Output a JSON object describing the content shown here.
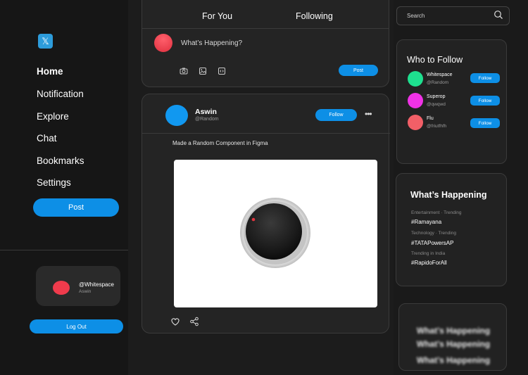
{
  "sidebar": {
    "logo": "𝕏",
    "nav": [
      "Home",
      "Notification",
      "Explore",
      "Chat",
      "Bookmarks",
      "Settings"
    ],
    "post_label": "Post",
    "profile": {
      "handle": "@Whitespace",
      "name": "Aswin"
    },
    "logout_label": "Log Out"
  },
  "compose": {
    "tabs": [
      "For You",
      "Following"
    ],
    "placeholder": "What’s Happening?",
    "post_label": "Post"
  },
  "post": {
    "name": "Aswin",
    "handle": "@Random",
    "follow_label": "Follow",
    "more": "•••",
    "text": "Made a Random Component in Figma"
  },
  "search": {
    "placeholder": "Search"
  },
  "who_to_follow": {
    "title": "Who to Follow",
    "follow_label": "Follow",
    "users": [
      {
        "name": "Whitespace",
        "handle": "@Random",
        "color": "#1ee08f"
      },
      {
        "name": "Superop",
        "handle": "@qwqwd",
        "color": "#f032e6"
      },
      {
        "name": "Flu",
        "handle": "@friutfhfh",
        "color": "#f25f67"
      }
    ]
  },
  "whats_happening": {
    "title": "What’s Happening",
    "trends": [
      {
        "category": "Entertainment · Trending",
        "tag": "#Ramayana"
      },
      {
        "category": "Technology · Trending",
        "tag": "#TATAPowersAP"
      },
      {
        "category": "Trending in India",
        "tag": "#RapidoForAll"
      }
    ]
  },
  "blurred_card": {
    "lines": [
      "What’s Happening",
      "What’s Happening",
      "What’s Happening"
    ]
  },
  "colors": {
    "accent": "#0d8fe6",
    "background": "#1a1a1a",
    "card": "#242424"
  }
}
